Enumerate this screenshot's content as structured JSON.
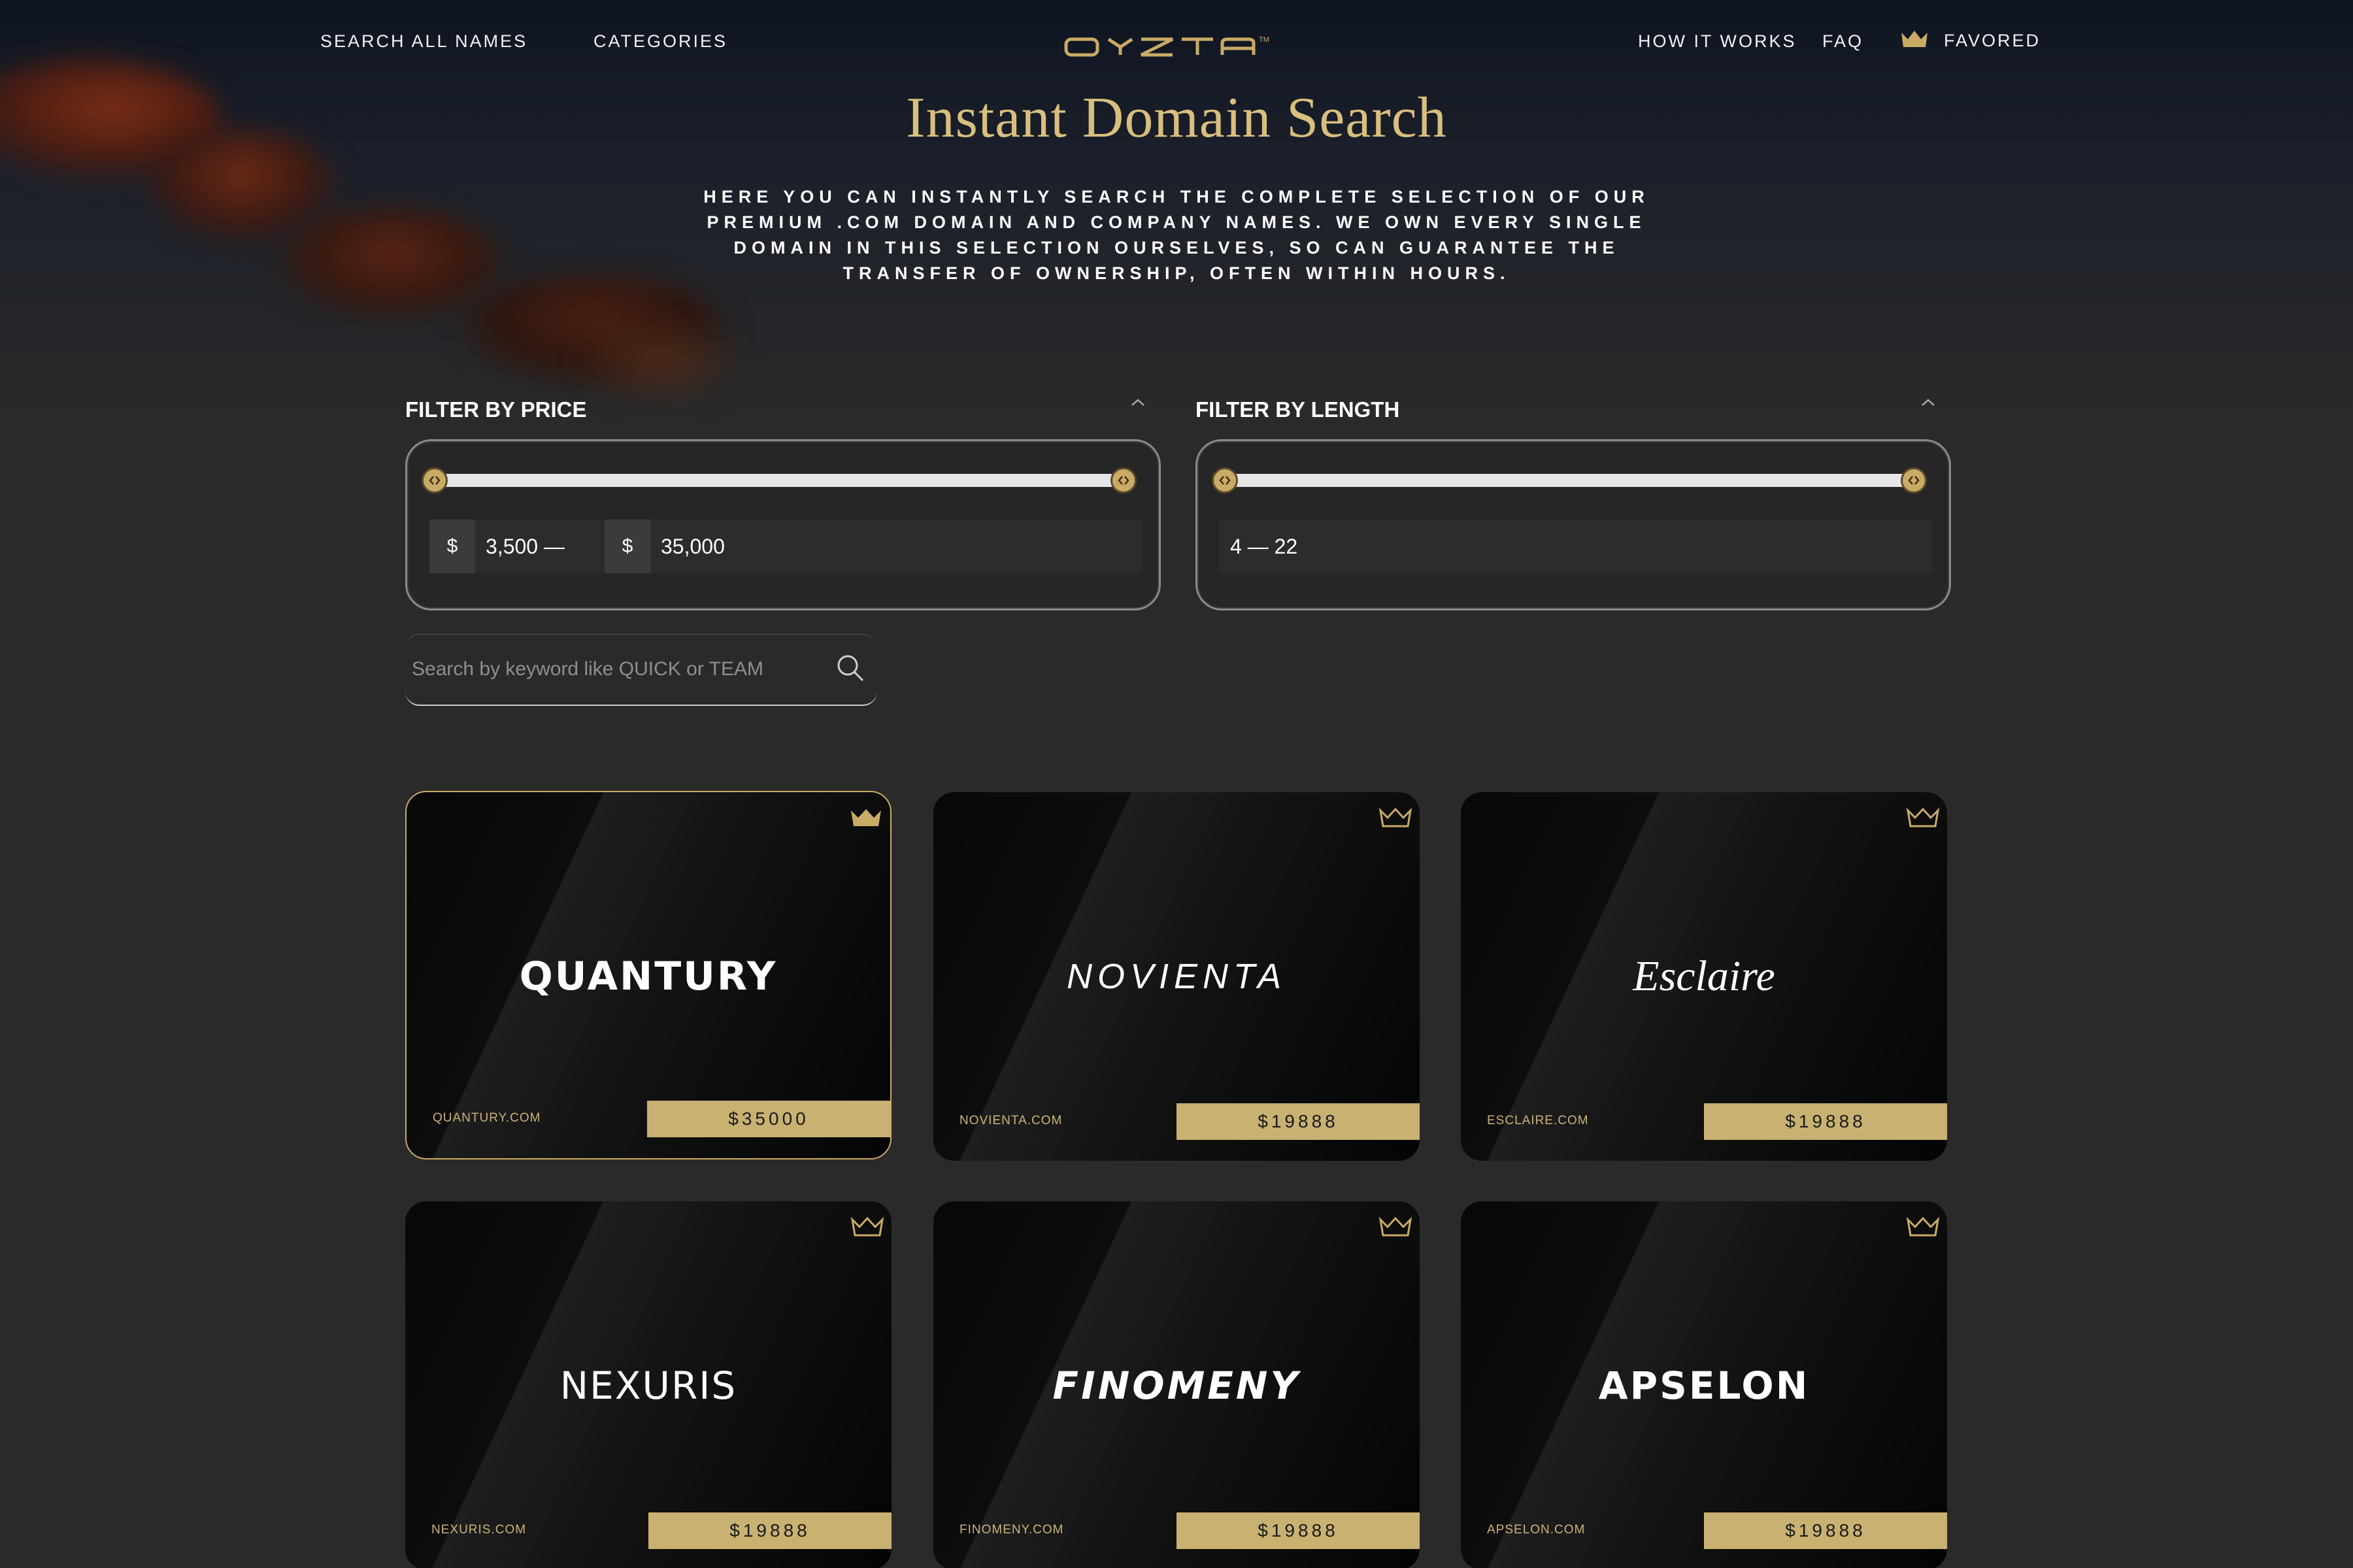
{
  "nav": {
    "search_all": "SEARCH ALL NAMES",
    "categories": "CATEGORIES",
    "logo": "OYZTA",
    "how_it_works": "HOW IT WORKS",
    "faq": "FAQ",
    "favored": "FAVORED"
  },
  "hero": {
    "title": "Instant Domain Search",
    "intro": "HERE YOU CAN INSTANTLY SEARCH THE COMPLETE SELECTION OF OUR PREMIUM .COM DOMAIN AND COMPANY NAMES. WE OWN EVERY SINGLE DOMAIN IN THIS SELECTION OURSELVES, SO CAN GUARANTEE THE TRANSFER OF OWNERSHIP, OFTEN WITHIN HOURS."
  },
  "filters": {
    "price": {
      "label": "FILTER BY PRICE",
      "currency": "$",
      "min": "3,500 —",
      "max": "35,000"
    },
    "length": {
      "label": "FILTER BY LENGTH",
      "range": "4 — 22"
    }
  },
  "search": {
    "placeholder": "Search by keyword like QUICK or TEAM"
  },
  "colors": {
    "accent_gold": "#c9b171",
    "title_gold": "#d9bf7e",
    "background": "#2a2a2a"
  },
  "cards": [
    {
      "name": "QUANTURY",
      "domain": "QUANTURY.COM",
      "price": "$35000",
      "favored": true
    },
    {
      "name": "NOVIENTA",
      "domain": "NOVIENTA.COM",
      "price": "$19888",
      "favored": false
    },
    {
      "name": "Esclaire",
      "domain": "ESCLAIRE.COM",
      "price": "$19888",
      "favored": false
    },
    {
      "name": "NEXURIS",
      "domain": "NEXURIS.COM",
      "price": "$19888",
      "favored": false
    },
    {
      "name": "FINOMENY",
      "domain": "FINOMENY.COM",
      "price": "$19888",
      "favored": false
    },
    {
      "name": "APSELON",
      "domain": "APSELON.COM",
      "price": "$19888",
      "favored": false
    }
  ]
}
